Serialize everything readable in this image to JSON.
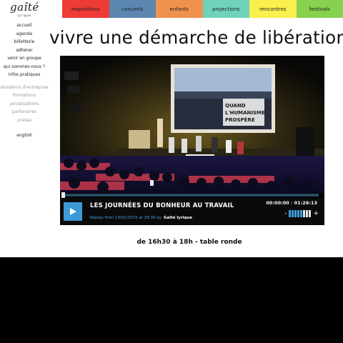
{
  "logo": {
    "main": "gaîté",
    "sub": "lyrique"
  },
  "nav": {
    "tabs": [
      {
        "label": "expositions",
        "color": "#ef3b35"
      },
      {
        "label": "concerts",
        "color": "#5b86b0"
      },
      {
        "label": "enfants",
        "color": "#f0924e"
      },
      {
        "label": "projections",
        "color": "#6fd3ba"
      },
      {
        "label": "rencontres",
        "color": "#f9ef4d"
      },
      {
        "label": "festivals",
        "color": "#86d14e"
      }
    ]
  },
  "sidebar": {
    "primary": [
      "accueil",
      "agenda",
      "billetterie",
      "adhérer",
      "venir en groupe",
      "qui sommes-nous ?",
      "infos pratiques"
    ],
    "secondary": [
      "résidence d'entreprise",
      "formations",
      "privatisations",
      "partenaires",
      "presse"
    ],
    "language": "english"
  },
  "page": {
    "title": "vivre une démarche de libération"
  },
  "player": {
    "title": "LES JOURNÉES DU BONHEUR AU TRAVAIL",
    "replay_label": "Replay from 13/02/2015 at 18:30 by",
    "brand": "Gaîté lyrique",
    "time_current": "00:00:00",
    "time_separator": "/",
    "time_total": "01:26:13",
    "progress": 0,
    "volume_level": 0.625,
    "volume_minus": "-",
    "volume_plus": "+",
    "slide_text_1": "QUAND",
    "slide_text_2": "L'HUMANISME",
    "slide_text_3": "PROSPÈRE",
    "accent": "#3d9ad6"
  },
  "caption": "de 16h30 à 18h - table ronde"
}
